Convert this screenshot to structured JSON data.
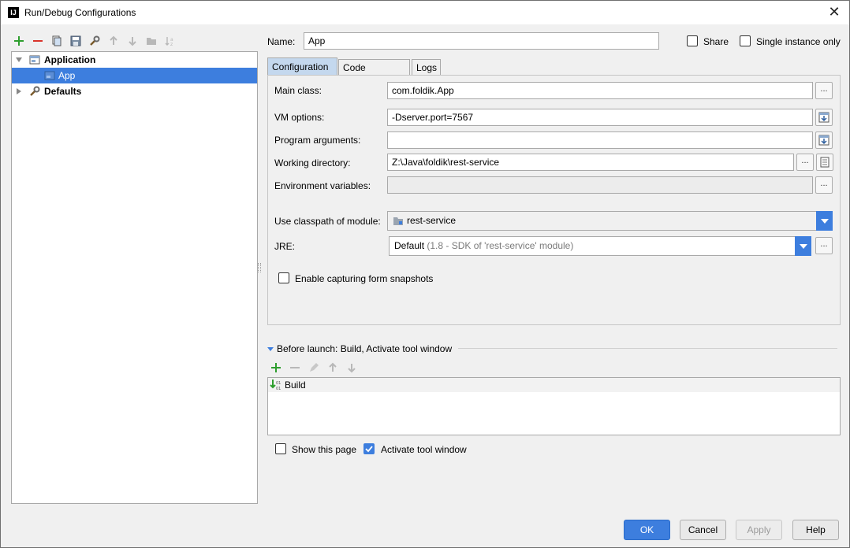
{
  "window": {
    "title": "Run/Debug Configurations",
    "app_icon": "IJ"
  },
  "toolbar": {
    "icons": [
      "add-icon",
      "remove-icon",
      "copy-icon",
      "save-icon",
      "wrench-icon",
      "arrow-up-icon",
      "arrow-down-icon",
      "folder-icon",
      "sort-icon"
    ]
  },
  "tree": {
    "items": [
      {
        "label": "Application"
      },
      {
        "label": "App"
      },
      {
        "label": "Defaults"
      }
    ]
  },
  "header": {
    "name_label": "Name:",
    "name_value": "App",
    "share_label": "Share",
    "single_instance_label": "Single instance only"
  },
  "tabs": [
    {
      "label": "Configuration"
    },
    {
      "label": "Code Coverage"
    },
    {
      "label": "Logs"
    }
  ],
  "config": {
    "main_class_label": "Main class:",
    "main_class_value": "com.foldik.App",
    "vm_options_label": "VM options:",
    "vm_options_value": "-Dserver.port=7567",
    "program_args_label": "Program arguments:",
    "program_args_value": "",
    "working_dir_label": "Working directory:",
    "working_dir_value": "Z:\\Java\\foldik\\rest-service",
    "env_vars_label": "Environment variables:",
    "env_vars_value": "",
    "classpath_label": "Use classpath of module:",
    "classpath_value": "rest-service",
    "jre_label": "JRE:",
    "jre_value": "Default",
    "jre_hint": "(1.8 - SDK of 'rest-service' module)",
    "snapshots_label": "Enable capturing form snapshots",
    "ellipsis": "..."
  },
  "before_launch": {
    "header": "Before launch: Build, Activate tool window",
    "items": [
      {
        "label": "Build"
      }
    ]
  },
  "options": {
    "show_page_label": "Show this page",
    "activate_tool_label": "Activate tool window",
    "show_page_checked": false,
    "activate_tool_checked": true
  },
  "buttons": {
    "ok": "OK",
    "cancel": "Cancel",
    "apply": "Apply",
    "help": "Help"
  },
  "colors": {
    "accent": "#3d7ede",
    "add": "#2e9e2e",
    "remove": "#d9342b"
  }
}
